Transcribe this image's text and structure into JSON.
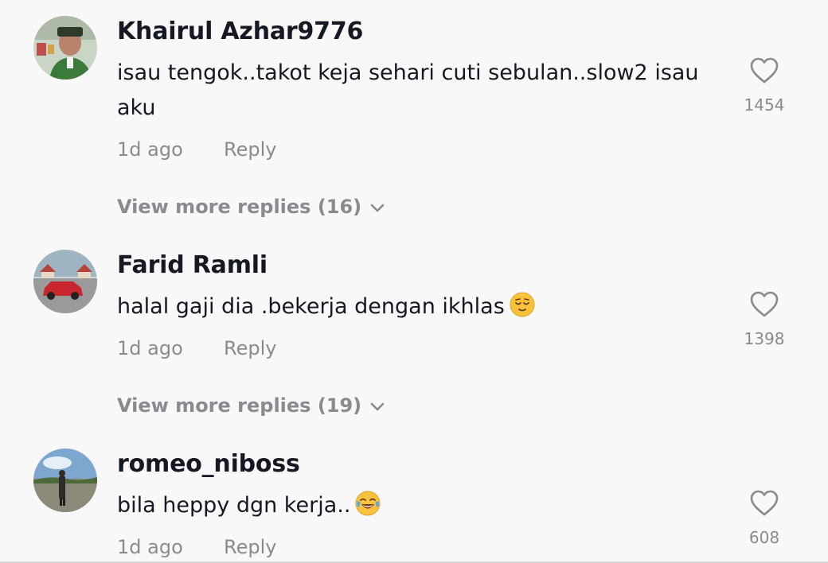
{
  "comments": [
    {
      "username": "Khairul Azhar9776",
      "text": "isau tengok..takot keja sehari cuti sebulan..slow2 isau aku",
      "time": "1d ago",
      "reply_label": "Reply",
      "likes": "1454",
      "more_replies": "View more replies (16)",
      "avatar_icon": "avatar-photo-man-green-songkok"
    },
    {
      "username": "Farid Ramli",
      "text": "halal gaji dia .bekerja dengan ikhlas",
      "emoji": "relieved-face-emoji",
      "time": "1d ago",
      "reply_label": "Reply",
      "likes": "1398",
      "more_replies": "View more replies (19)",
      "avatar_icon": "avatar-photo-red-car"
    },
    {
      "username": "romeo_niboss",
      "text": "bila heppy dgn kerja..",
      "emoji": "tears-of-joy-emoji",
      "time": "1d ago",
      "reply_label": "Reply",
      "likes": "608",
      "avatar_icon": "avatar-photo-person-outdoors"
    }
  ],
  "colors": {
    "background": "#f8f8f8",
    "primary_text": "#161823",
    "secondary_text": "#8a8b91"
  }
}
